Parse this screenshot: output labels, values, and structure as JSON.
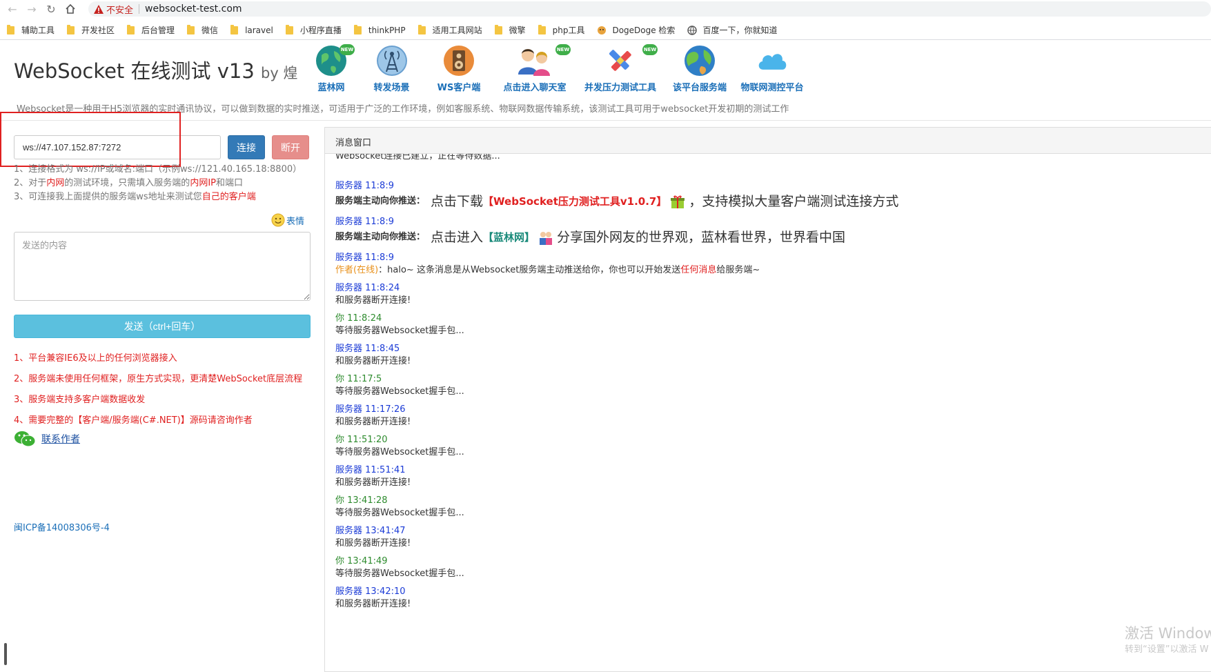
{
  "browser": {
    "insecure_label": "不安全",
    "url": "websocket-test.com",
    "bookmarks": [
      "辅助工具",
      "开发社区",
      "后台管理",
      "微信",
      "laravel",
      "小程序直播",
      "thinkPHP",
      "适用工具网站",
      "微擎",
      "php工具",
      "DogeDoge 检索",
      "百度一下，你就知道"
    ]
  },
  "header": {
    "title": "WebSocket 在线测试 v13",
    "by": "by 煌",
    "nav": [
      {
        "label": "蓝林网",
        "new": true
      },
      {
        "label": "转发场景",
        "new": false
      },
      {
        "label": "WS客户端",
        "new": false
      },
      {
        "label": "点击进入聊天室",
        "new": true
      },
      {
        "label": "并发压力测试工具",
        "new": true
      },
      {
        "label": "该平台服务端",
        "new": false
      },
      {
        "label": "物联网测控平台",
        "new": false
      }
    ],
    "new_badge": "NEW",
    "subtitle": "Websocket是一种用于H5浏览器的实时通讯协议，可以做到数据的实时推送，可适用于广泛的工作环境，例如客服系统、物联网数据传输系统，该测试工具可用于websocket开发初期的测试工作"
  },
  "left": {
    "ws_url": "ws://47.107.152.87:7272",
    "connect_label": "连接",
    "disconnect_label": "断开",
    "tips": {
      "t1": "1、连接格式为 ws://IP或域名:端口（示例ws://121.40.165.18:8800）",
      "t2a": "2、对于",
      "t2b": "内网",
      "t2c": "的测试环境，只需填入服务端的",
      "t2d": "内网IP",
      "t2e": "和端口",
      "t3a": "3、可连接我上面提供的服务端ws地址来测试您",
      "t3b": "自己的客户端"
    },
    "emoji_label": "表情",
    "send_placeholder": "发送的内容",
    "send_label": "发送（ctrl+回车）",
    "features": [
      "1、平台兼容IE6及以上的任何浏览器接入",
      "2、服务端未使用任何框架，原生方式实现，更清楚WebSocket底层流程",
      "3、服务端支持多客户端数据收发",
      "4、需要完整的【客户端/服务端(C#.NET)】源码请咨询作者"
    ],
    "contact_label": "联系作者",
    "icp": "闽ICP备14008306号-4"
  },
  "messages": {
    "title": "消息窗口",
    "top_text": "Websocket连接已建立，正在等待数据...",
    "push_label": "服务端主动向你推送：",
    "push1": {
      "who": "服务器 11:8:9",
      "a": "点击下载",
      "link": "【WebSocket压力测试工具v1.0.7】",
      "b": "，支持模拟大量客户端测试连接方式"
    },
    "push2": {
      "who": "服务器 11:8:9",
      "a": "点击进入",
      "link": "【蓝林网】",
      "b": "分享国外网友的世界观，蓝林看世界，世界看中国"
    },
    "author_msg": {
      "who": "服务器 11:8:9",
      "author": "作者(在线)",
      "a": "：halo~ 这条消息是从Websocket服务端主动推送给你，你也可以开始发送",
      "r": "任何消息",
      "b": "给服务端~"
    },
    "list": [
      {
        "who": "服务器 11:8:24",
        "type": "srv",
        "text": "和服务器断开连接!"
      },
      {
        "who": "你 11:8:24",
        "type": "you",
        "text": "等待服务器Websocket握手包..."
      },
      {
        "who": "服务器 11:8:45",
        "type": "srv",
        "text": "和服务器断开连接!"
      },
      {
        "who": "你 11:17:5",
        "type": "you",
        "text": "等待服务器Websocket握手包..."
      },
      {
        "who": "服务器 11:17:26",
        "type": "srv",
        "text": "和服务器断开连接!"
      },
      {
        "who": "你 11:51:20",
        "type": "you",
        "text": "等待服务器Websocket握手包..."
      },
      {
        "who": "服务器 11:51:41",
        "type": "srv",
        "text": "和服务器断开连接!"
      },
      {
        "who": "你 13:41:28",
        "type": "you",
        "text": "等待服务器Websocket握手包..."
      },
      {
        "who": "服务器 13:41:47",
        "type": "srv",
        "text": "和服务器断开连接!"
      },
      {
        "who": "你 13:41:49",
        "type": "you",
        "text": "等待服务器Websocket握手包..."
      },
      {
        "who": "服务器 13:42:10",
        "type": "srv",
        "text": "和服务器断开连接!"
      }
    ]
  },
  "watermark": {
    "line1": "激活 Window",
    "line2": "转到“设置”以激活 W"
  },
  "colors": {
    "primary": "#337ab7",
    "info": "#5bc0de",
    "danger": "#e68e8b",
    "red": "#e02020",
    "server": "#1b3bd6",
    "you": "#2e8b2e"
  }
}
